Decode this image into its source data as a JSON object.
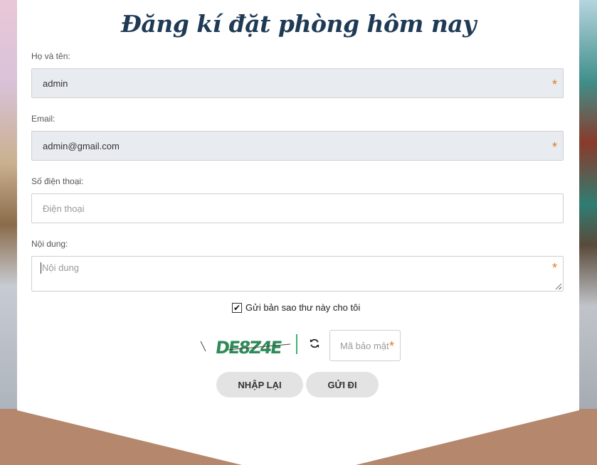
{
  "form": {
    "title": "Đăng kí đặt phòng hôm nay",
    "name": {
      "label": "Họ và tên:",
      "value": "admin",
      "required_mark": "*"
    },
    "email": {
      "label": "Email:",
      "value": "admin@gmail.com",
      "required_mark": "*"
    },
    "phone": {
      "label": "Số điện thoại:",
      "placeholder": "Điện thoại"
    },
    "content": {
      "label": "Nội dung:",
      "placeholder": "Nội dung",
      "required_mark": "*"
    },
    "copy_checkbox": {
      "label": "Gửi bản sao thư này cho tôi",
      "checked": true,
      "check_glyph": "✔"
    },
    "captcha": {
      "image_text": "DE8Z4E",
      "input_placeholder": "Mã bảo mật",
      "required_mark": "*",
      "refresh_icon": "refresh-icon"
    },
    "buttons": {
      "reset": "NHẬP LẠI",
      "submit": "GỬI ĐI"
    }
  },
  "colors": {
    "title": "#1f3a55",
    "required": "#e07b20",
    "filled_bg": "#e8ebf0",
    "button_bg": "#e3e3e3",
    "footer_brown": "#b5876c",
    "captcha_green": "#2e8b57"
  }
}
